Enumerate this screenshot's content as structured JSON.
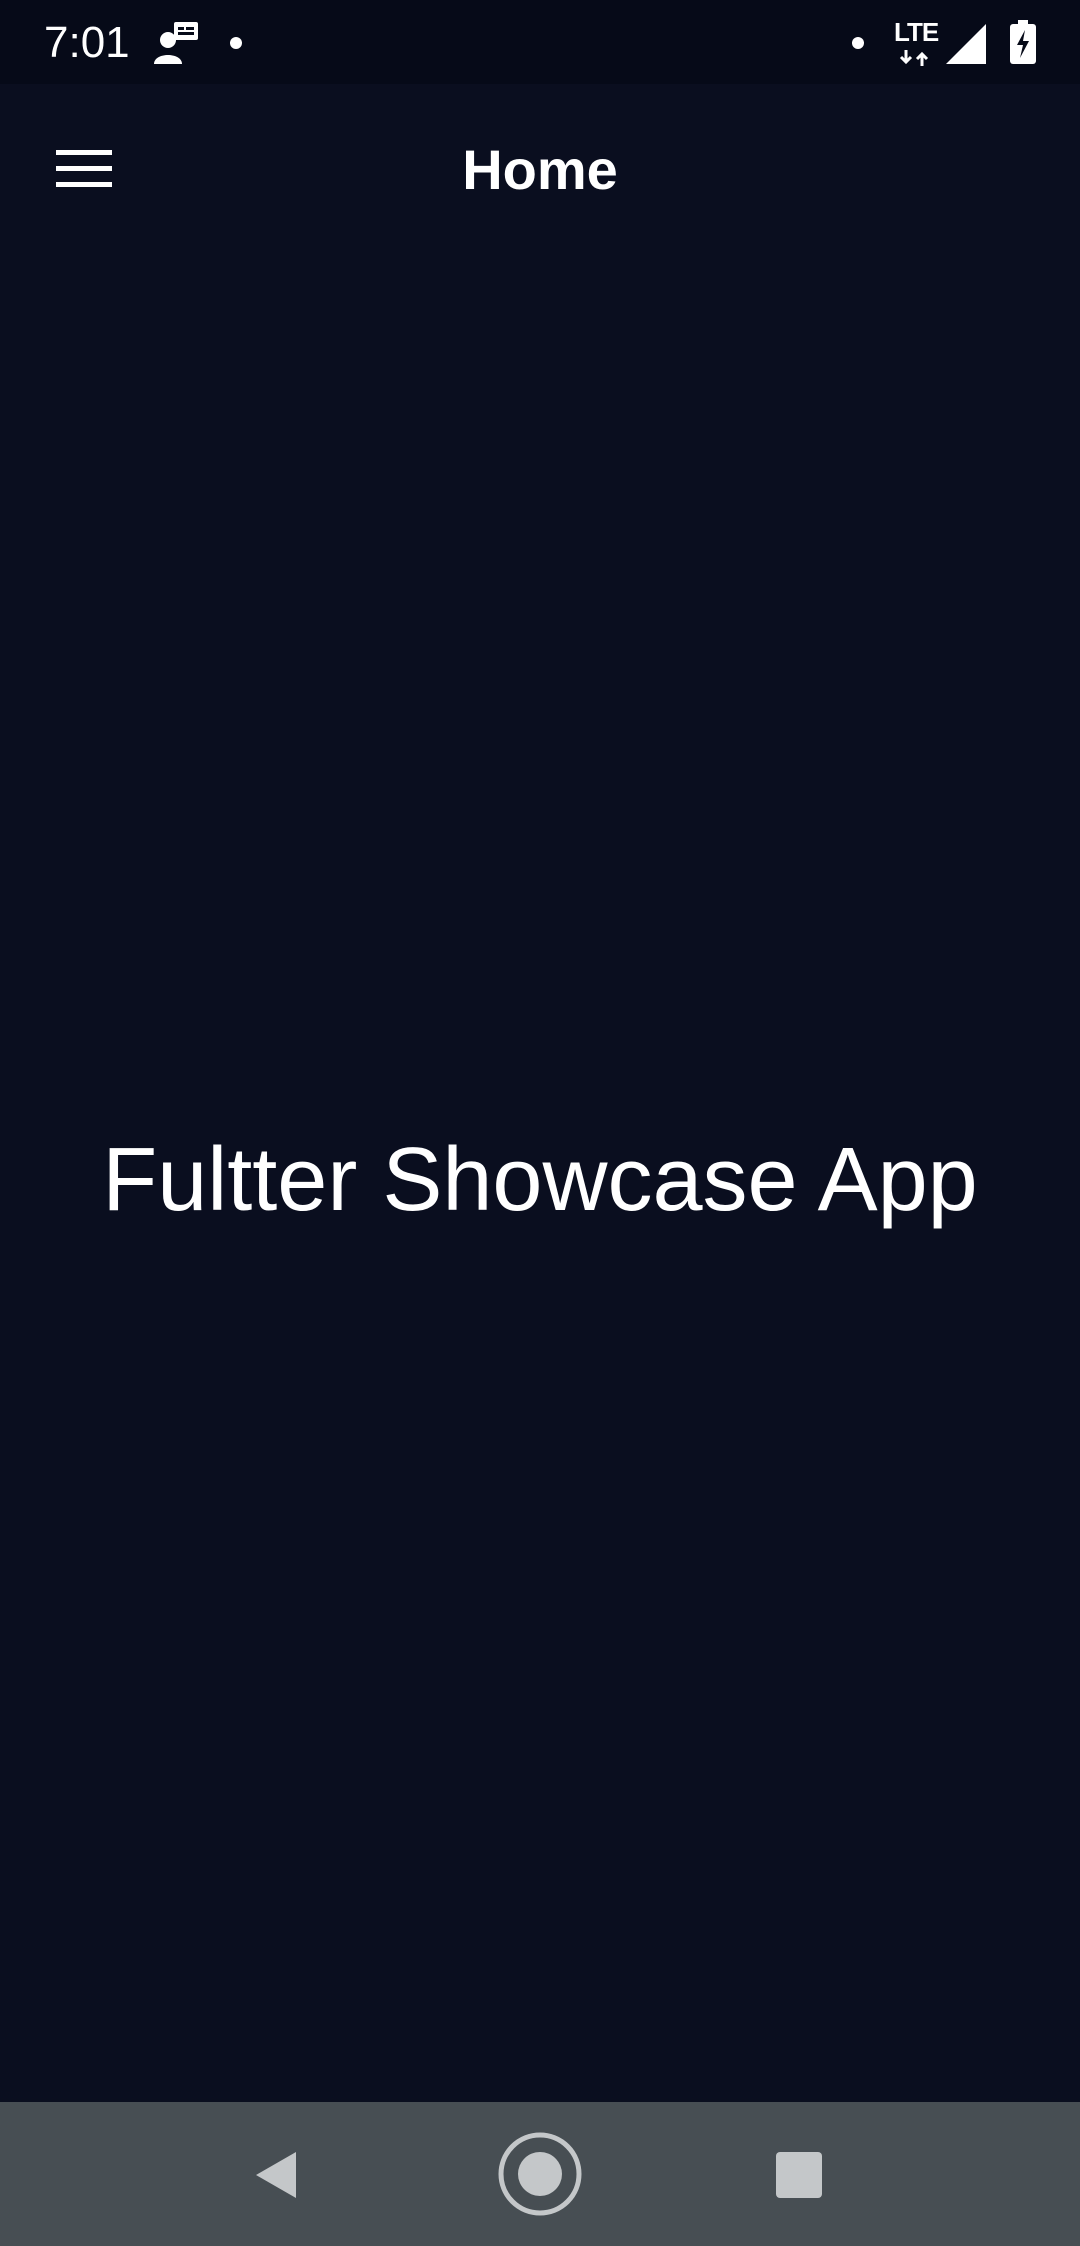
{
  "status_bar": {
    "time": "7:01",
    "network": "LTE",
    "icons": [
      "account-notification-icon",
      "notification-dot-icon",
      "status-dot-icon",
      "lte-data-icon",
      "cell-signal-icon",
      "battery-charging-icon"
    ]
  },
  "app_bar": {
    "title": "Home",
    "menu_icon": "hamburger-menu-icon"
  },
  "body": {
    "heading": "Fultter Showcase App"
  },
  "nav_bar": {
    "buttons": [
      "back-icon",
      "home-icon",
      "recents-icon"
    ]
  },
  "colors": {
    "background": "#0a0e1f",
    "status_bar": "#060a18",
    "nav_bar": "#474e53",
    "text": "#ffffff",
    "nav_icon": "#c4c7c9"
  }
}
